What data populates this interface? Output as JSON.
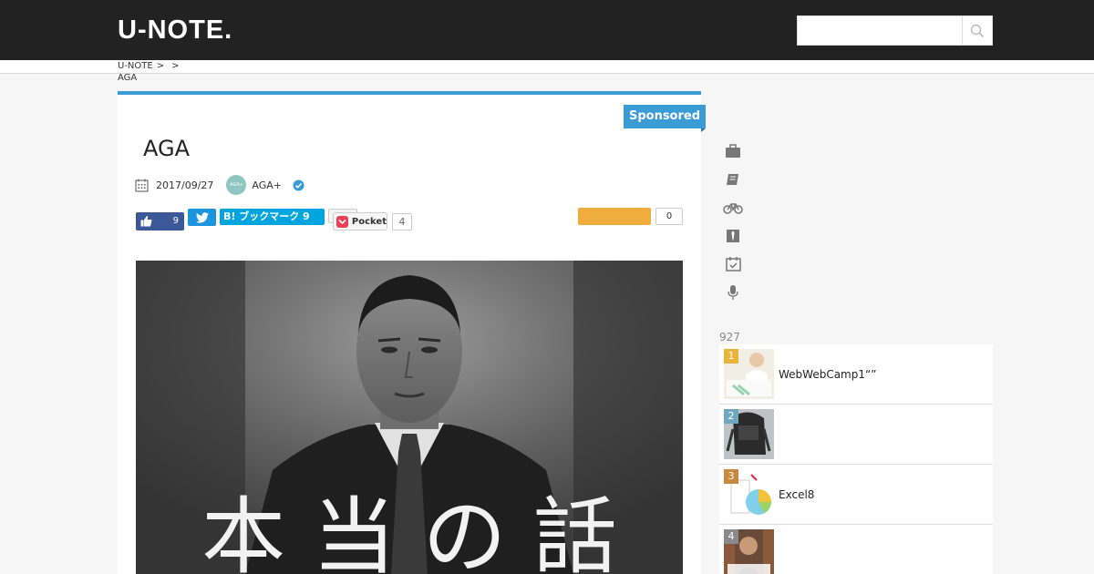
{
  "header": {
    "logo": "U-NOTE.",
    "search_placeholder": ""
  },
  "breadcrumb": {
    "home": "U-NOTE",
    "sep1": ">",
    "sep2": ">",
    "current": "AGA"
  },
  "article": {
    "badge": "Sponsored",
    "title": "AGA",
    "date": "2017/09/27",
    "author_avatar_text": "AGA+",
    "author": "AGA+",
    "hero_caption": "本 当 の 話"
  },
  "share": {
    "fb_count": "9",
    "hatena_label": "B! ブックマーク 9",
    "pocket_label": "Pocket",
    "pocket_count": "4",
    "stock_count": "0"
  },
  "sidebar": {
    "categories": [
      {
        "icon": "briefcase-icon"
      },
      {
        "icon": "book-icon"
      },
      {
        "icon": "bicycle-icon"
      },
      {
        "icon": "tie-icon"
      },
      {
        "icon": "calendar-check-icon"
      },
      {
        "icon": "microphone-icon"
      }
    ],
    "ranking_count": "927",
    "ranking": [
      {
        "rank": "1",
        "title": "WebWebCamp1“”",
        "color": "#e8b43a"
      },
      {
        "rank": "2",
        "title": "",
        "color": "#6fa7c0"
      },
      {
        "rank": "3",
        "title": "Excel8",
        "color": "#c9883f"
      },
      {
        "rank": "4",
        "title": "",
        "color": "#8a8a8a"
      }
    ]
  },
  "colors": {
    "header_bg": "#222222",
    "accent": "#3a9bd5",
    "facebook": "#3b5998",
    "twitter": "#1b95e0",
    "hatena": "#00a4de",
    "pocket": "#ee4056",
    "orange": "#f0ad3d"
  }
}
